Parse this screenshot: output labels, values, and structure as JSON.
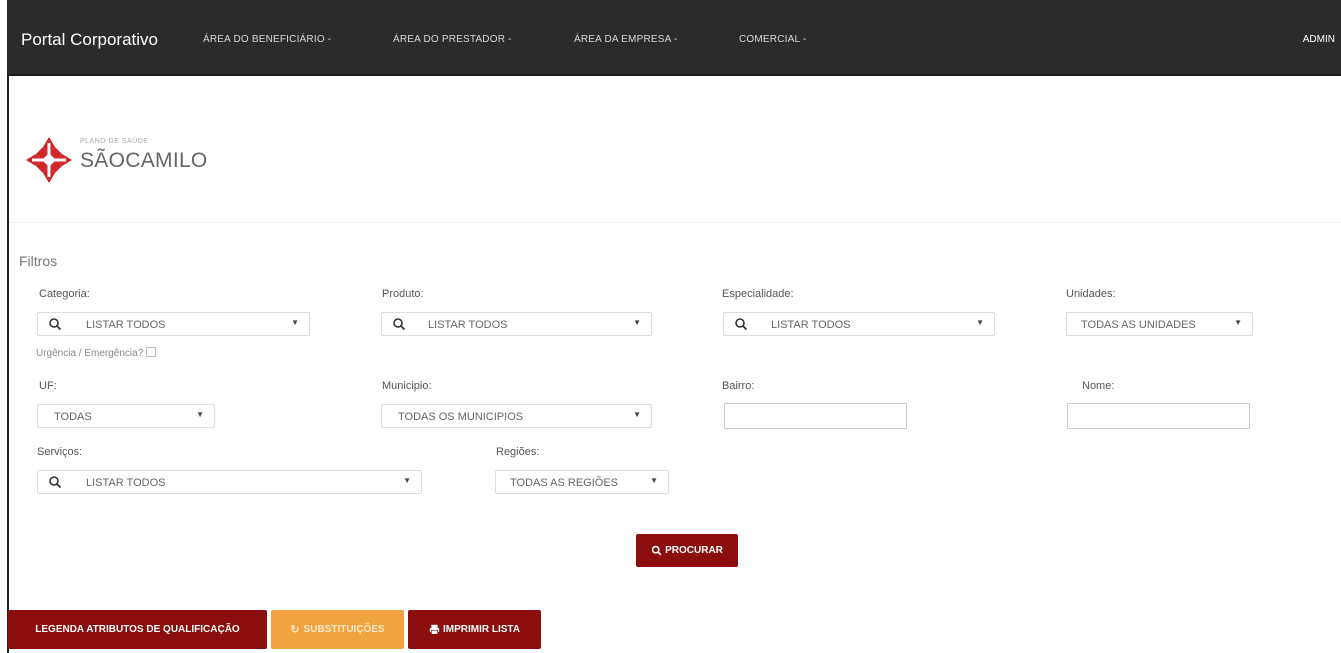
{
  "navbar": {
    "brand": "Portal Corporativo",
    "items": [
      {
        "label": "ÁREA DO BENEFICIÁRIO -"
      },
      {
        "label": "ÁREA DO PRESTADOR -"
      },
      {
        "label": "ÁREA DA EMPRESA -"
      },
      {
        "label": "COMERCIAL -"
      }
    ],
    "user": "ADMIN"
  },
  "logo": {
    "small_text": "PLANO DE SAÚDE",
    "big_text": "SÃOCAMILO",
    "color": "#d0262c"
  },
  "filters": {
    "title": "Filtros",
    "categoria": {
      "label": "Categoria:",
      "value": "LISTAR TODOS"
    },
    "produto": {
      "label": "Produto:",
      "value": "LISTAR TODOS"
    },
    "especialidade": {
      "label": "Especialidade:",
      "value": "LISTAR TODOS"
    },
    "unidades": {
      "label": "Unidades:",
      "value": "TODAS AS UNIDADES"
    },
    "urgencia": {
      "label": "Urgência / Emergência?"
    },
    "uf": {
      "label": "UF:",
      "value": "TODAS"
    },
    "municipio": {
      "label": "Municipio:",
      "value": "TODAS OS MUNICIPIOS"
    },
    "bairro": {
      "label": "Bairro:",
      "value": ""
    },
    "nome": {
      "label": "Nome:",
      "value": ""
    },
    "servicos": {
      "label": "Serviços:",
      "value": "LISTAR TODOS"
    },
    "regioes": {
      "label": "Regiões:",
      "value": "TODAS AS REGIÕES"
    }
  },
  "actions": {
    "search_label": "PROCURAR",
    "legend_label": "LEGENDA ATRIBUTOS DE QUALIFICAÇÃO",
    "substitutions_label": "SUBSTITUIÇÕES",
    "print_label": "IMPRIMIR LISTA"
  },
  "colors": {
    "navbar": "#2b2b2b",
    "primary_red": "#8b0d0d",
    "warning_orange": "#f0a340"
  }
}
